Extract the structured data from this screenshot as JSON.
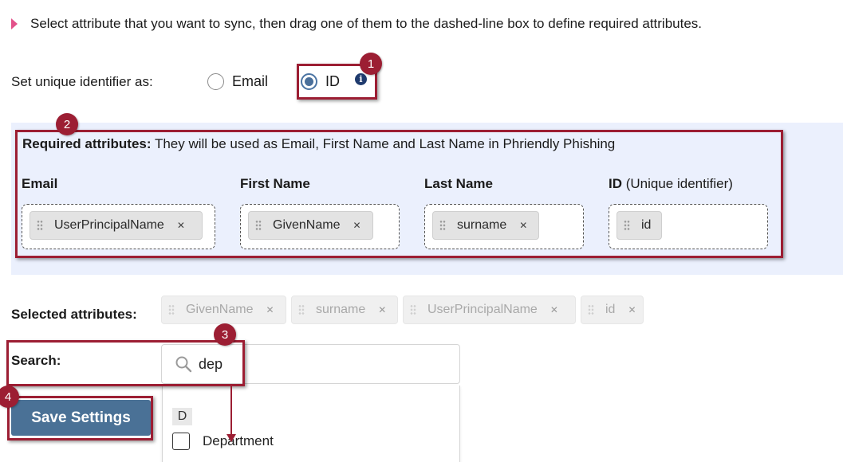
{
  "intro": {
    "text": "Select attribute that you want to sync, then drag one of them to the dashed-line box to define required attributes."
  },
  "unique_id": {
    "label": "Set unique identifier as:",
    "options": [
      {
        "label": "Email",
        "checked": false
      },
      {
        "label": "ID",
        "checked": true
      }
    ],
    "info_icon": "info-icon"
  },
  "required": {
    "title_bold": "Required attributes:",
    "title_rest": " They will be used as Email, First Name and Last Name in Phriendly Phishing",
    "columns": [
      {
        "header": "Email",
        "header_note": "",
        "chip": "UserPrincipalName",
        "removable": true
      },
      {
        "header": "First Name",
        "header_note": "",
        "chip": "GivenName",
        "removable": true
      },
      {
        "header": "Last Name",
        "header_note": "",
        "chip": "surname",
        "removable": true
      },
      {
        "header": "ID",
        "header_note": " (Unique identifier)",
        "chip": "id",
        "removable": false
      }
    ]
  },
  "selected": {
    "label": "Selected attributes:",
    "chips": [
      "GivenName",
      "surname",
      "UserPrincipalName",
      "id"
    ]
  },
  "search": {
    "label": "Search:",
    "value": "dep",
    "icon": "search-icon"
  },
  "dropdown": {
    "group": "D",
    "items": [
      {
        "label": "Department",
        "checked": false
      }
    ]
  },
  "save_button": {
    "label": "Save Settings"
  },
  "callouts": [
    "1",
    "2",
    "3",
    "4"
  ],
  "colors": {
    "accent": "#9c1e33",
    "panel": "#ebf0fd",
    "button": "#4a7196",
    "radio": "#4a6f9a"
  }
}
